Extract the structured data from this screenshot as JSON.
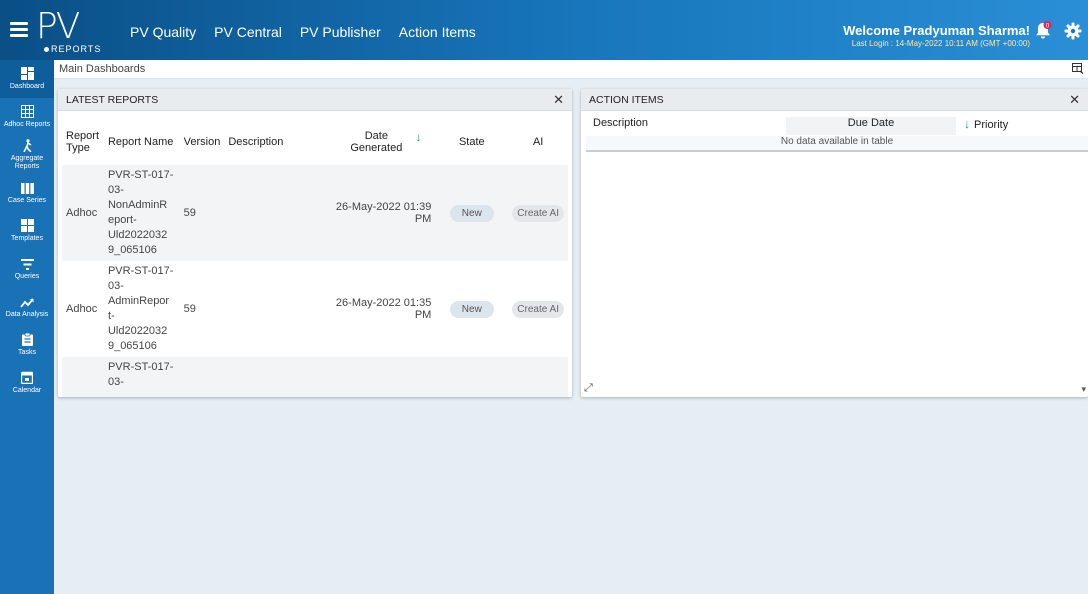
{
  "header": {
    "logo_text": "PV",
    "logo_sub": "REPORTS",
    "nav": [
      "PV Quality",
      "PV Central",
      "PV Publisher",
      "Action Items"
    ],
    "welcome": "Welcome Pradyuman Sharma!",
    "last_login": "Last Login : 14-May-2022 10:11 AM (GMT +00:00)",
    "notification_count": "0"
  },
  "sidebar": {
    "items": [
      {
        "label": "Dashboard",
        "icon": "dashboard-icon"
      },
      {
        "label": "Adhoc Reports",
        "icon": "grid-icon"
      },
      {
        "label": "Aggregate Reports",
        "icon": "figure-icon"
      },
      {
        "label": "Case Series",
        "icon": "columns-icon"
      },
      {
        "label": "Templates",
        "icon": "templates-icon"
      },
      {
        "label": "Queries",
        "icon": "filter-icon"
      },
      {
        "label": "Data Analysis",
        "icon": "trend-icon"
      },
      {
        "label": "Tasks",
        "icon": "clipboard-icon"
      },
      {
        "label": "Calendar",
        "icon": "calendar-icon"
      }
    ]
  },
  "breadcrumb": "Main Dashboards",
  "latest_reports": {
    "title": "LATEST REPORTS",
    "columns": {
      "report_type": "Report Type",
      "report_name": "Report Name",
      "version": "Version",
      "description": "Description",
      "date_generated": "Date Generated",
      "state": "State",
      "ai": "AI"
    },
    "rows": [
      {
        "type": "Adhoc",
        "name_lines": [
          "PVR-ST-017-",
          "03-",
          "NonAdminR",
          "eport-",
          "Uld2022032",
          "9_065106"
        ],
        "version": "59",
        "description": "",
        "date": "26-May-2022 01:39 PM",
        "state": "New",
        "ai": "Create AI"
      },
      {
        "type": "Adhoc",
        "name_lines": [
          "PVR-ST-017-",
          "03-",
          "AdminRepor",
          "t-",
          "Uld2022032",
          "9_065106"
        ],
        "version": "59",
        "description": "",
        "date": "26-May-2022 01:35 PM",
        "state": "New",
        "ai": "Create AI"
      },
      {
        "type": "",
        "name_lines": [
          "PVR-ST-017-",
          "03-"
        ],
        "version": "",
        "description": "",
        "date": "",
        "state": "",
        "ai": ""
      }
    ]
  },
  "action_items": {
    "title": "ACTION ITEMS",
    "columns": {
      "description": "Description",
      "due_date": "Due Date",
      "priority": "Priority"
    },
    "empty_text": "No data available in table"
  },
  "colors": {
    "topbar": "#1877bd",
    "sidebar": "#1a72b6",
    "link": "#4a8cc5",
    "sort_arrow": "#2b7fd0"
  }
}
